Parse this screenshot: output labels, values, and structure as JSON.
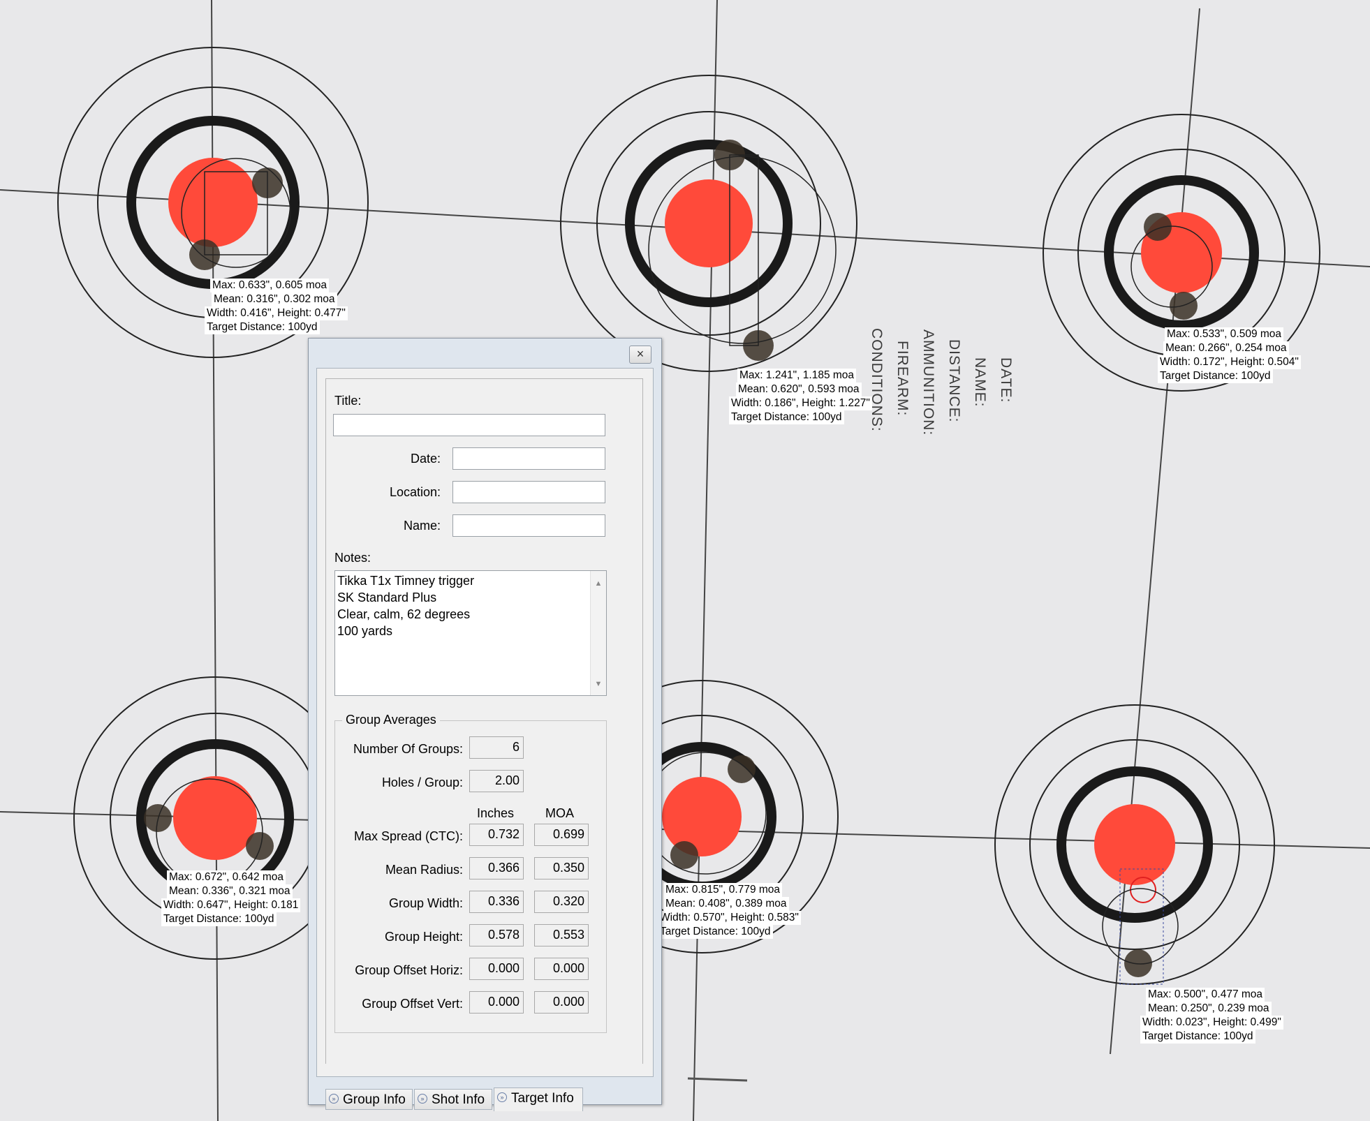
{
  "background": {
    "paper_color": "#e9e9eb",
    "bullseye_color": "#ff4a3a",
    "printed_form": [
      "DATE:",
      "NAME:",
      "DISTANCE:",
      "AMMUNITION:",
      "FIREARM:",
      "CONDITIONS:"
    ]
  },
  "groups": [
    {
      "max": "Max: 0.633\", 0.605 moa",
      "mean": "Mean: 0.316\", 0.302 moa",
      "size": "Width: 0.416\", Height: 0.477\"",
      "distance": "Target Distance: 100yd"
    },
    {
      "max": "Max: 1.241\", 1.185 moa",
      "mean": "Mean: 0.620\", 0.593 moa",
      "size": "Width: 0.186\", Height: 1.227\"",
      "distance": "Target Distance: 100yd"
    },
    {
      "max": "Max: 0.533\", 0.509 moa",
      "mean": "Mean: 0.266\", 0.254 moa",
      "size": "Width: 0.172\", Height: 0.504\"",
      "distance": "Target Distance: 100yd"
    },
    {
      "max": "Max: 0.672\", 0.642 moa",
      "mean": "Mean: 0.336\", 0.321 moa",
      "size": "Width: 0.647\", Height: 0.181",
      "distance": "Target Distance: 100yd"
    },
    {
      "max": "Max: 0.815\", 0.779 moa",
      "mean": "Mean: 0.408\", 0.389 moa",
      "size": "Width: 0.570\", Height: 0.583\"",
      "distance": "Target Distance: 100yd"
    },
    {
      "max": "Max: 0.500\", 0.477 moa",
      "mean": "Mean: 0.250\", 0.239 moa",
      "size": "Width: 0.023\", Height: 0.499\"",
      "distance": "Target Distance: 100yd"
    }
  ],
  "dialog": {
    "close_icon": "×",
    "title_label": "Title:",
    "title_value": "",
    "date_label": "Date:",
    "date_value": "",
    "location_label": "Location:",
    "location_value": "",
    "name_label": "Name:",
    "name_value": "",
    "notes_label": "Notes:",
    "notes_lines": [
      "Tikka T1x Timney trigger",
      "SK Standard Plus",
      "Clear, calm, 62 degrees",
      "100 yards"
    ],
    "group_averages": {
      "legend": "Group Averages",
      "number_of_groups_label": "Number Of Groups:",
      "number_of_groups": "6",
      "holes_per_group_label": "Holes / Group:",
      "holes_per_group": "2.00",
      "col_inches": "Inches",
      "col_moa": "MOA",
      "rows": [
        {
          "label": "Max Spread (CTC):",
          "inches": "0.732",
          "moa": "0.699"
        },
        {
          "label": "Mean Radius:",
          "inches": "0.366",
          "moa": "0.350"
        },
        {
          "label": "Group Width:",
          "inches": "0.336",
          "moa": "0.320"
        },
        {
          "label": "Group Height:",
          "inches": "0.578",
          "moa": "0.553"
        },
        {
          "label": "Group Offset Horiz:",
          "inches": "0.000",
          "moa": "0.000"
        },
        {
          "label": "Group Offset Vert:",
          "inches": "0.000",
          "moa": "0.000"
        }
      ]
    },
    "tabs": [
      {
        "label": "Group Info",
        "icon": "tab-arrow-icon"
      },
      {
        "label": "Shot Info",
        "icon": "tab-arrow-icon"
      },
      {
        "label": "Target Info",
        "icon": "tab-arrow-icon",
        "active": true
      }
    ]
  }
}
